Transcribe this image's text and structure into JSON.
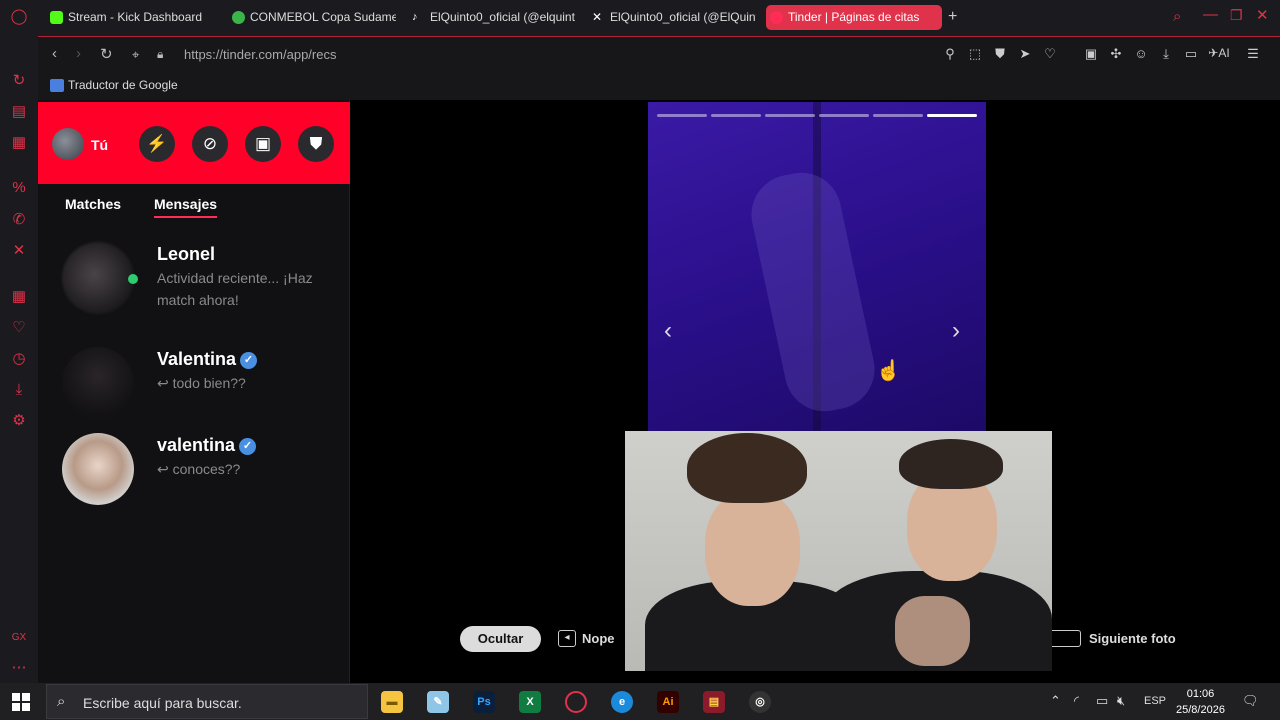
{
  "browser": {
    "tabs": [
      {
        "title": "Stream - Kick Dashboard",
        "icon": "kick-icon",
        "color": "#53fc18"
      },
      {
        "title": "CONMEBOL Copa Sudame",
        "icon": "conmebol-icon",
        "color": "#3ab54a"
      },
      {
        "title": "ElQuinto0_oficial (@elquint",
        "icon": "tiktok-icon",
        "color": "#ffffff"
      },
      {
        "title": "ElQuinto0_oficial (@ElQuint",
        "icon": "x-icon",
        "color": "#ffffff"
      },
      {
        "title": "Tinder | Páginas de citas",
        "icon": "tinder-icon",
        "color": "#ff2d55"
      }
    ],
    "new_tab": "+",
    "url": "https://tinder.com/app/recs",
    "bookmark": "Traductor de Google",
    "accent": "#e0324a"
  },
  "tinder": {
    "me_label": "Tú",
    "tabs": [
      "Matches",
      "Mensajes"
    ],
    "active_tab": "Mensajes",
    "conversations": [
      {
        "name": "Leonel",
        "message": "Actividad reciente... ¡Haz match ahora!",
        "verified": false,
        "online": true
      },
      {
        "name": "Valentina",
        "message": "↩ todo bien??",
        "verified": true,
        "online": false
      },
      {
        "name": "valentina",
        "message": "↩ conoces??",
        "verified": true,
        "online": false
      }
    ],
    "controls": {
      "hide": "Ocultar",
      "nope": "Nope",
      "next_photo": "Siguiente foto"
    },
    "photo_count": 6,
    "active_photo": 6,
    "brand_color": "#ff0028"
  },
  "taskbar": {
    "search_placeholder": "Escribe aquí para buscar.",
    "language": "ESP",
    "time": "01:06",
    "date": "25/8/2026"
  }
}
